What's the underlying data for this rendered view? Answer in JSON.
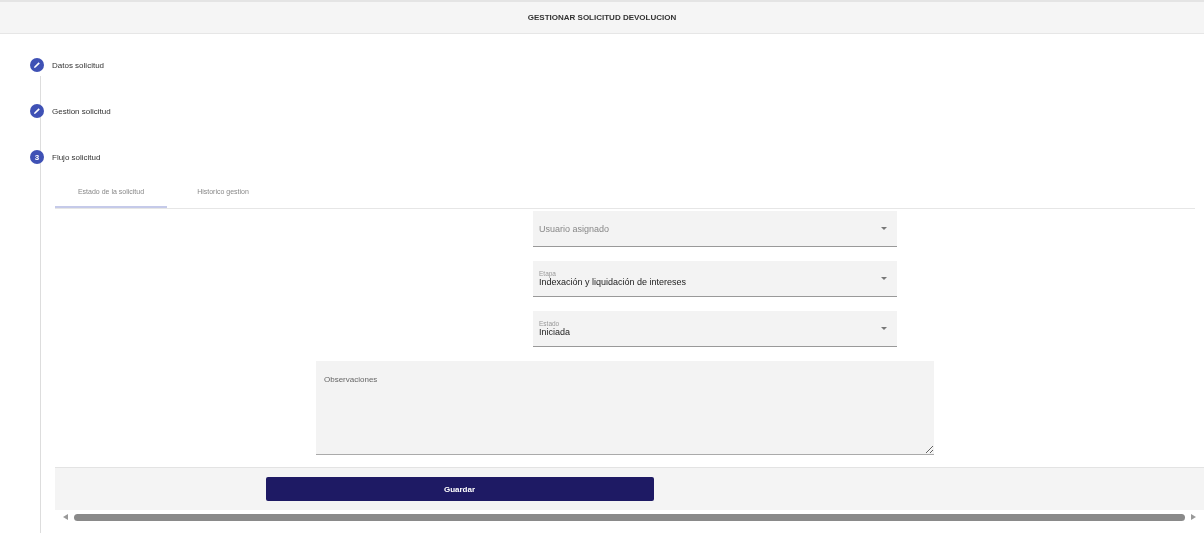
{
  "header": {
    "title": "GESTIONAR SOLICITUD DEVOLUCION"
  },
  "steps": [
    {
      "kind": "edit",
      "label": "Datos solicitud"
    },
    {
      "kind": "edit",
      "label": "Gestion solicitud"
    },
    {
      "kind": "number",
      "number": "3",
      "label": "Flujo solicitud"
    }
  ],
  "tabs": [
    {
      "label": "Estado de la solicitud",
      "selected": true
    },
    {
      "label": "Historico gestion",
      "selected": false
    }
  ],
  "fields": [
    {
      "placeholder": "Usuario asignado"
    },
    {
      "label": "Etapa",
      "value": "Indexación y liquidación de intereses"
    },
    {
      "label": "Estado",
      "value": "Iniciada"
    }
  ],
  "observations": {
    "placeholder": "Observaciones"
  },
  "save_button": "Guardar"
}
